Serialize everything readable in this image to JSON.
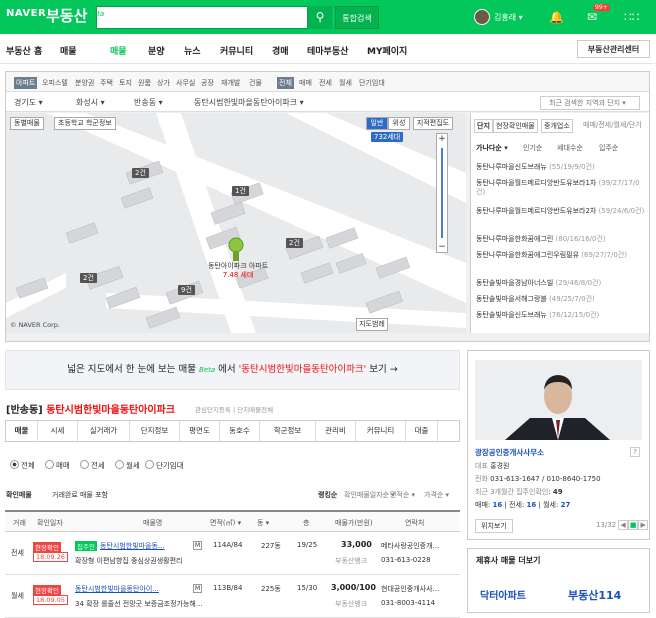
{
  "header": {
    "logo": "NAVER",
    "service": "부동산",
    "search_button": "통합검색",
    "user_name": "김홍래 ▾",
    "mail_badge": "99+"
  },
  "nav": {
    "items": [
      "부동산 홈",
      "매물",
      "매물",
      "분양",
      "뉴스",
      "커뮤니티",
      "경매",
      "테마부동산",
      "MY페이지"
    ],
    "beta": "Beta",
    "manager_center": "부동산관리센터"
  },
  "type_filter": {
    "items": [
      "아파트",
      "오피스텔",
      "분양권",
      "주택",
      "토지",
      "원룸",
      "상가",
      "사무실",
      "공장",
      "재개발",
      "건물",
      "전체",
      "매매",
      "전세",
      "월세",
      "단기임대"
    ]
  },
  "location": {
    "items": [
      "경기도 ▾",
      "화성시 ▾",
      "반송동 ▾",
      "동탄시범한빛마을동탄아이파크 ▾"
    ],
    "recent": "최근 검색한 지역과 단지 ▾"
  },
  "map": {
    "checks": [
      "동별매물",
      "초등학교 학군정보"
    ],
    "view_buttons": [
      "일반",
      "위성",
      "지적편집도"
    ],
    "scale": "732세대",
    "pin_name": "동탄아이파크 아파트",
    "pin_price": "7.48 세대",
    "count_labels": [
      "2건",
      "1건",
      "2건",
      "2건",
      "9건"
    ],
    "map_view_btn": "지도범례",
    "copyright": "© NAVER Corp."
  },
  "right_list": {
    "tabs": [
      "단지",
      "현장확인매물",
      "중개업소",
      "매매/전세/월세/단기"
    ],
    "sorts": [
      "가나다순 ▾",
      "인기순",
      "세대수순",
      "입주순"
    ],
    "items": [
      {
        "name": "동탄나루마을신도브래뉴",
        "info": "(55/19/9/0건)"
      },
      {
        "name": "동탄나루마을월드메르디앙반도유보라1차",
        "info": "(39/27/17/0건)"
      },
      {
        "name": "동탄나루마을월드메르디앙반도유보라2차",
        "info": "(59/24/6/0건)"
      },
      {
        "name": "동탄나루마을한화꿈에그린",
        "info": "(80/16/16/0건)"
      },
      {
        "name": "동탄나루마을한화꿈에그린우림필유",
        "info": "(69/27/7/0건)"
      },
      {
        "name": "동탄솔빛마을경남아너스빌",
        "info": "(29/46/8/0건)"
      },
      {
        "name": "동탄솔빛마을서해그랑블",
        "info": "(49/25/7/0건)"
      },
      {
        "name": "동탄솔빛마을신도브래뉴",
        "info": "(76/12/15/0건)"
      }
    ]
  },
  "banner": {
    "pre": "넓은 지도에서 한 눈에 보는 매물 ",
    "beta": "Beta",
    "mid": " 에서 ",
    "name": "'동탄시범한빛마을동탄아이파크'",
    "post": " 보기 →"
  },
  "complex": {
    "dong": "[반송동]",
    "name": "동탄시범한빛마을동탄아이파크",
    "tag1": "관심단지등록",
    "tag2": "단지매물전체"
  },
  "tabs": [
    "매물",
    "시세",
    "실거래가",
    "단지정보",
    "평면도",
    "동호수",
    "학군정보",
    "관리비",
    "커뮤니티",
    "대출"
  ],
  "radios": [
    "전체",
    "매매",
    "전세",
    "월세",
    "단기임대"
  ],
  "filter": {
    "confirm": "확인매물",
    "same": "거래완료 매물 포함",
    "sort": [
      "랭킹순",
      "확인매물일자순 ▾",
      "면적순 ▾",
      "가격순 ▾"
    ]
  },
  "table": {
    "headers": [
      "거래",
      "확인일자",
      "매물명",
      "면적(㎡) ▾",
      "동 ▾",
      "층",
      "매물가(만원)",
      "연락처"
    ],
    "rows": [
      {
        "deal": "전세",
        "badge": "현장확인",
        "date": "18.09.26",
        "confirm": "집주인",
        "name": "동탄시범한빛마을동...",
        "desc": "확장형 이편남향집 중심상권생활편리",
        "area": "114A/84",
        "dong": "227동",
        "floor": "19/25",
        "price": "33,000",
        "sub": "부동산뱅크",
        "agent": "메타사랑공인중개...",
        "phone": "031-613-0228"
      },
      {
        "deal": "월세",
        "badge": "현장확인",
        "date": "18.09.05",
        "confirm": "",
        "name": "동탄시범한빛마을동탄아이...",
        "desc": "34 확장 를줄선 전망굿 보증금조정가능해...",
        "area": "113B/84",
        "dong": "225동",
        "floor": "15/30",
        "price": "3,000/100",
        "sub": "부동산뱅크",
        "agent": "현대공인중개사사...",
        "phone": "031-8003-4114"
      }
    ]
  },
  "agent": {
    "office": "광장공인중개사사무소",
    "rep_label": "대표",
    "rep": "홍경원",
    "tel_label": "전화",
    "tel": "031-613-1647 / 010-8640-1750",
    "recent": "최근 3개월간 집주인확인",
    "recent_count": "49",
    "sale_label": "매매",
    "sale": "16",
    "jeonse_label": "전세",
    "jeonse": "16",
    "wolse_label": "월세",
    "wolse": "27",
    "map_btn": "위치보기",
    "page": "13/32"
  },
  "partner": {
    "title": "제휴사 매물 더보기",
    "logo1": "닥터아파트",
    "logo2": "부동산114"
  }
}
